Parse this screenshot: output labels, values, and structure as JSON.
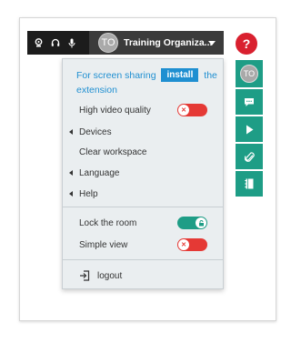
{
  "topbar": {
    "icons": [
      "webcam-icon",
      "headset-icon",
      "microphone-icon"
    ],
    "avatar_initials": "TO",
    "user_name": "Training Organiza...",
    "help_label": "?"
  },
  "side_tools": {
    "avatar_initials": "TO",
    "buttons": [
      "chat-icon",
      "play-icon",
      "paperclip-icon",
      "notebook-icon"
    ]
  },
  "dropdown": {
    "share_text_before": "For screen sharing",
    "install_label": "install",
    "share_text_after": "the extension",
    "high_video_quality": {
      "label": "High video quality",
      "state": "off"
    },
    "devices_label": "Devices",
    "clear_workspace_label": "Clear workspace",
    "language_label": "Language",
    "help_label": "Help",
    "lock_room": {
      "label": "Lock the room",
      "state": "on"
    },
    "simple_view": {
      "label": "Simple view",
      "state": "off"
    },
    "logout_label": "logout"
  },
  "colors": {
    "accent_blue": "#1f8fd1",
    "teal": "#1e9d86",
    "red": "#e53935",
    "topbar": "#1c1c1c"
  }
}
